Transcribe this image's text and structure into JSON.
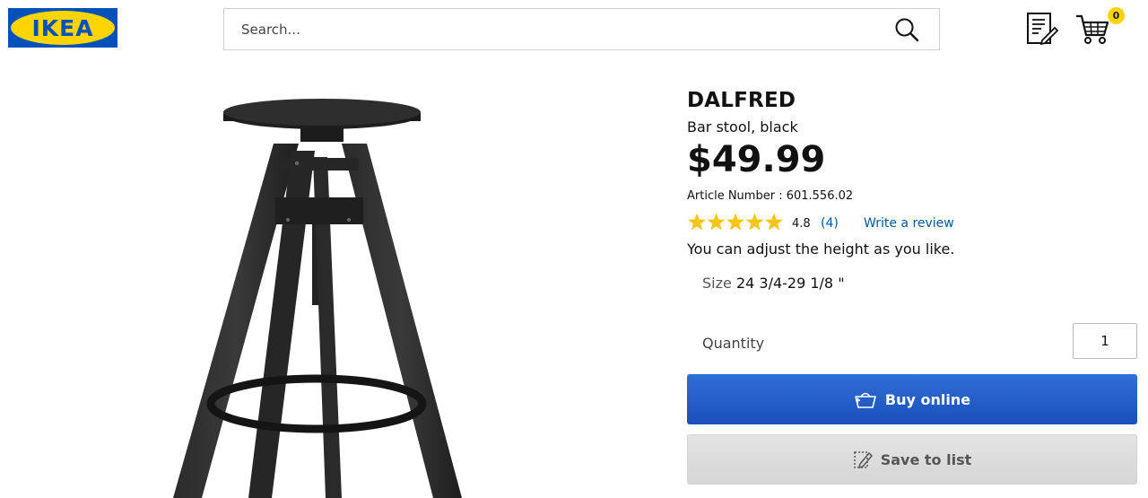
{
  "header": {
    "logo_text": "IKEA",
    "search": {
      "placeholder": "Search...",
      "value": ""
    },
    "cart_count": "0",
    "icons": [
      "search-icon",
      "shopping-list-icon",
      "cart-icon"
    ]
  },
  "product": {
    "name": "DALFRED",
    "description": "Bar stool, black",
    "price": "$49.99",
    "article_number": "Article Number : 601.556.02",
    "rating": {
      "value": "4.8",
      "stars": 5,
      "count": "(4)"
    },
    "write_review": "Write a review",
    "tagline": "You can adjust the height as you like.",
    "size_label": "Size",
    "size_value": "24 3/4-29 1/8 \"",
    "quantity_label": "Quantity",
    "quantity_value": "1"
  },
  "actions": {
    "buy_label": "Buy online",
    "save_label": "Save to list"
  },
  "colors": {
    "brand_blue": "#0051ba",
    "brand_yellow": "#ffd400",
    "buy_button": "#2a64cc",
    "link": "#0058a3",
    "star": "#f5c518"
  }
}
